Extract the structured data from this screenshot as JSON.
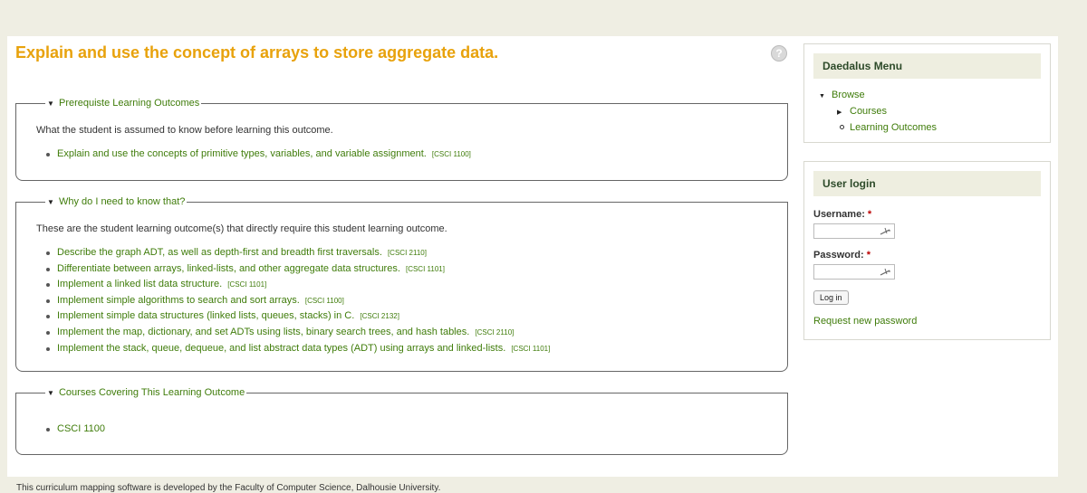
{
  "page": {
    "title": "Explain and use the concept of arrays to store aggregate data.",
    "help_icon": "?"
  },
  "prereq": {
    "legend": "Prerequiste Learning Outcomes",
    "description": "What the student is assumed to know before learning this outcome.",
    "items": [
      {
        "text": "Explain and use the concepts of primitive types, variables, and variable assignment.",
        "code": "[CSCI 1100]"
      }
    ]
  },
  "why": {
    "legend": "Why do I need to know that?",
    "description": "These are the student learning outcome(s) that directly require this student learning outcome.",
    "items": [
      {
        "text": "Describe the graph ADT, as well as depth-first and breadth first traversals.",
        "code": "[CSCI 2110]"
      },
      {
        "text": "Differentiate between arrays, linked-lists, and other aggregate data structures.",
        "code": "[CSCI 1101]"
      },
      {
        "text": "Implement a linked list data structure.",
        "code": "[CSCI 1101]"
      },
      {
        "text": "Implement simple algorithms to search and sort arrays.",
        "code": "[CSCI 1100]"
      },
      {
        "text": "Implement simple data structures (linked lists, queues, stacks) in C.",
        "code": "[CSCI 2132]"
      },
      {
        "text": "Implement the map, dictionary, and set ADTs using lists, binary search trees, and hash tables.",
        "code": "[CSCI 2110]"
      },
      {
        "text": "Implement the stack, queue, dequeue, and list abstract data types (ADT) using arrays and linked-lists.",
        "code": "[CSCI 1101]"
      }
    ]
  },
  "courses": {
    "legend": "Courses Covering This Learning Outcome",
    "items": [
      "CSCI 1100"
    ]
  },
  "menu": {
    "title": "Daedalus Menu",
    "browse": "Browse",
    "courses": "Courses",
    "learning_outcomes": "Learning Outcomes"
  },
  "login": {
    "title": "User login",
    "username_label": "Username:",
    "password_label": "Password:",
    "required_mark": "*",
    "button": "Log in",
    "request_password": "Request new password"
  },
  "footer": {
    "text": "This curriculum mapping software is developed by the Faculty of Computer Science, Dalhousie University."
  },
  "colors": {
    "title": "#e8a20c",
    "link": "#3f7c0a",
    "block_title_bg": "#eeeee0"
  }
}
